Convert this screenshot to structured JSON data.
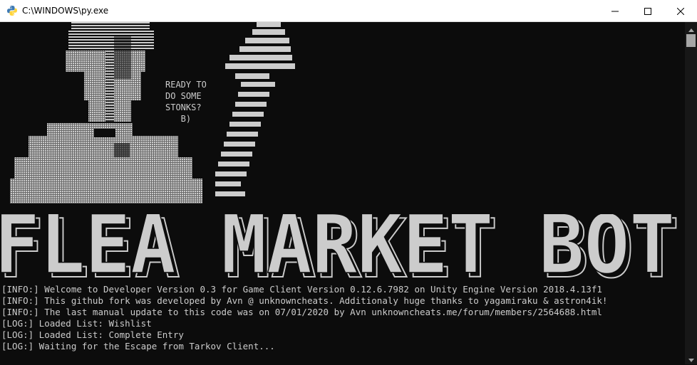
{
  "window": {
    "title": "C:\\WINDOWS\\py.exe",
    "icon": "python-icon",
    "buttons": [
      "minimize-icon",
      "maximize-icon",
      "close-icon"
    ]
  },
  "console": {
    "text_color": "#cccccc",
    "background": "#0c0c0c",
    "bubble_lines": [
      "READY TO",
      "DO SOME",
      "STONKS?",
      "   B)"
    ],
    "banner": "FLEA MARKET BOT",
    "log_lines": [
      "[INFO:] Welcome to Developer Version 0.3 for Game Client Version 0.12.6.7982 on Unity Engine Version 2018.4.13f1",
      "[INFO:] This github fork was developed by Avn @ unknowncheats. Additionaly huge thanks to yagamiraku & astron4ik!",
      "[INFO:] The last manual update to this code was on 07/01/2020 by Avn unknowncheats.me/forum/members/2564688.html",
      "[LOG:] Loaded List: Wishlist",
      "[LOG:] Loaded List: Complete Entry",
      "[LOG:] Waiting for the Escape from Tarkov Client..."
    ]
  }
}
